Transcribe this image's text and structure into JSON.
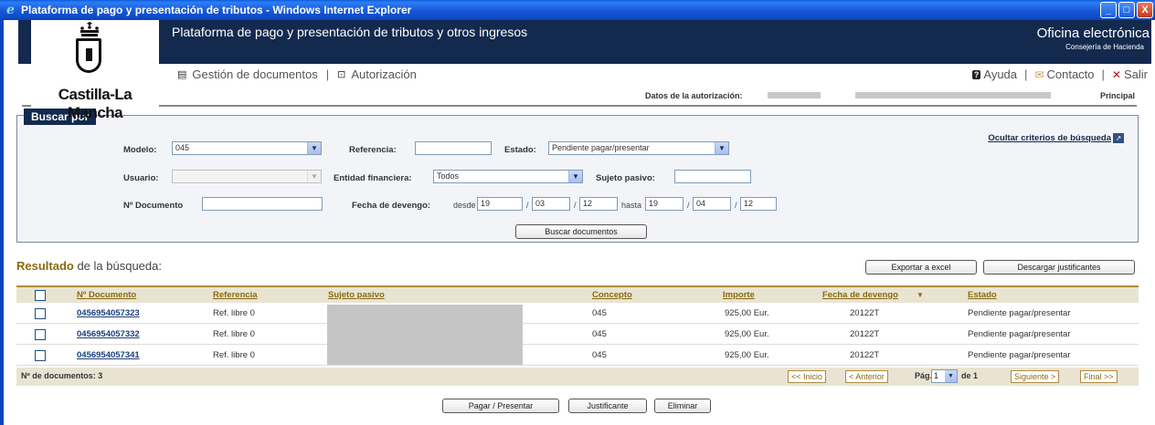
{
  "window": {
    "title": "Plataforma de pago y presentación de tributos - Windows Internet Explorer",
    "minimize": "_",
    "maximize": "□",
    "close": "X"
  },
  "header": {
    "logo_text": "Castilla-La Mancha",
    "title": "Plataforma de pago y presentación de tributos y otros ingresos",
    "office": "Oficina electrónica",
    "department": "Consejería de Hacienda"
  },
  "nav": {
    "documents": "Gestión de documentos",
    "separator": "|",
    "authorization": "Autorización",
    "help": "Ayuda",
    "contact": "Contacto",
    "exit": "Salir"
  },
  "auth": {
    "label": "Datos de la autorización:",
    "principal": "Principal"
  },
  "search": {
    "legend": "Buscar por",
    "hide_criteria": "Ocultar criterios de búsqueda",
    "modelo_label": "Modelo:",
    "modelo_value": "045",
    "referencia_label": "Referencia:",
    "referencia_value": "",
    "estado_label": "Estado:",
    "estado_value": "Pendiente pagar/presentar",
    "usuario_label": "Usuario:",
    "usuario_value": "",
    "entidad_label": "Entidad financiera:",
    "entidad_value": "Todos",
    "sujeto_label": "Sujeto pasivo:",
    "sujeto_value": "",
    "ndoc_label": "Nº Documento",
    "ndoc_value": "",
    "fecha_label": "Fecha de devengo:",
    "desde_label": "desde",
    "hasta_label": "hasta",
    "desde_day": "19",
    "desde_month": "03",
    "desde_year": "12",
    "hasta_day": "19",
    "hasta_month": "04",
    "hasta_year": "12",
    "date_sep": "/",
    "search_button": "Buscar documentos"
  },
  "results": {
    "title_bold": "Resultado",
    "title_rest": " de la búsqueda:",
    "export_button": "Exportar a excel",
    "download_button": "Descargar justificantes",
    "columns": {
      "ndoc": "Nº Documento",
      "referencia": "Referencia",
      "sujeto": "Sujeto pasivo",
      "concepto": "Concepto",
      "importe": "Importe",
      "fecha": "Fecha de devengo",
      "estado": "Estado"
    },
    "rows": [
      {
        "ndoc": "0456954057323",
        "referencia": "Ref. libre 0",
        "concepto": "045",
        "importe": "925,00 Eur.",
        "fecha": "20122T",
        "estado": "Pendiente pagar/presentar"
      },
      {
        "ndoc": "0456954057332",
        "referencia": "Ref. libre 0",
        "concepto": "045",
        "importe": "925,00 Eur.",
        "fecha": "20122T",
        "estado": "Pendiente pagar/presentar"
      },
      {
        "ndoc": "0456954057341",
        "referencia": "Ref. libre 0",
        "concepto": "045",
        "importe": "925,00 Eur.",
        "fecha": "20122T",
        "estado": "Pendiente pagar/presentar"
      }
    ],
    "count_label": "Nº de documentos: 3",
    "pagination": {
      "first": "<< Inicio",
      "prev": "< Anterior",
      "page_label": "Pág.",
      "page_value": "1",
      "of_label": "de 1",
      "next": "Siguiente >",
      "last": "Final >>"
    }
  },
  "actions": {
    "pay": "Pagar / Presentar",
    "receipt": "Justificante",
    "delete": "Eliminar"
  },
  "colors": {
    "header_bg": "#13294e",
    "accent_gold": "#8a6a10",
    "table_header_bg": "#e9e4d2"
  }
}
